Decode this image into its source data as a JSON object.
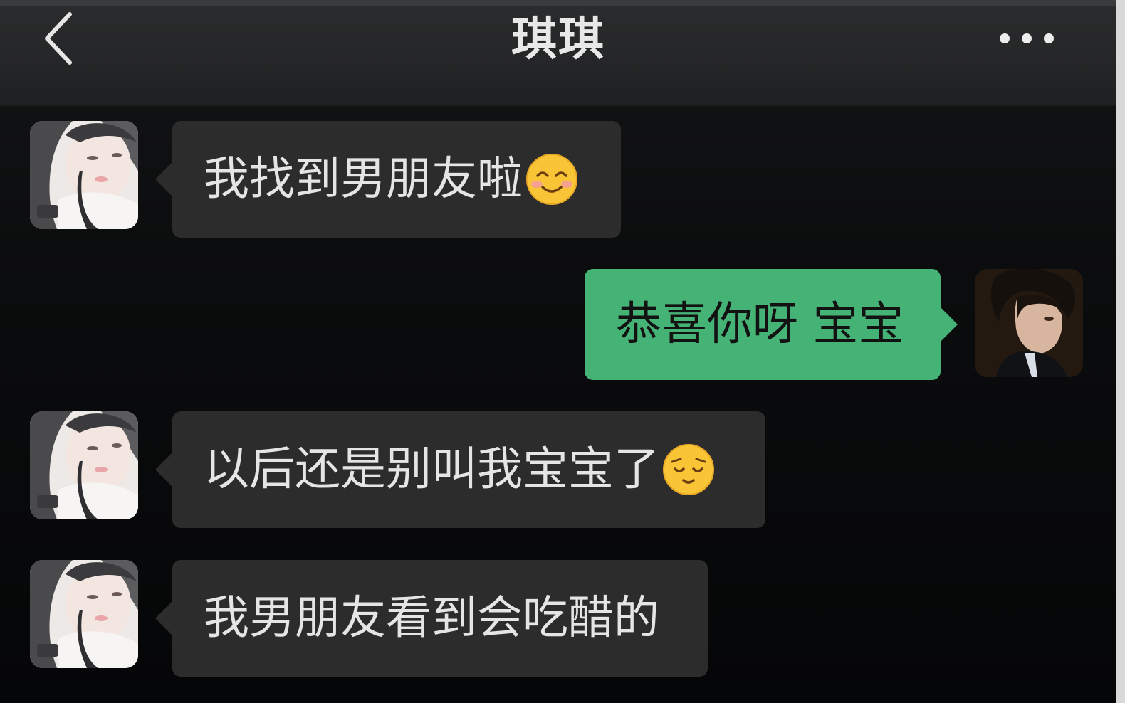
{
  "header": {
    "title": "琪琪",
    "back_icon": "chevron-left-icon",
    "more_icon": "more-dots-icon"
  },
  "messages": [
    {
      "sender": "contact",
      "text": "我找到男朋友啦",
      "emoji": "blushing-smile-emoji"
    },
    {
      "sender": "me",
      "text": "恭喜你呀 宝宝"
    },
    {
      "sender": "contact",
      "text": "以后还是别叫我宝宝了",
      "emoji": "relieved-face-emoji"
    },
    {
      "sender": "contact",
      "text": "我男朋友看到会吃醋的"
    }
  ],
  "colors": {
    "header_bg": "#262728",
    "incoming_bubble": "#2c2c2d",
    "outgoing_bubble": "#46b376",
    "background": "#0a0b0c"
  }
}
